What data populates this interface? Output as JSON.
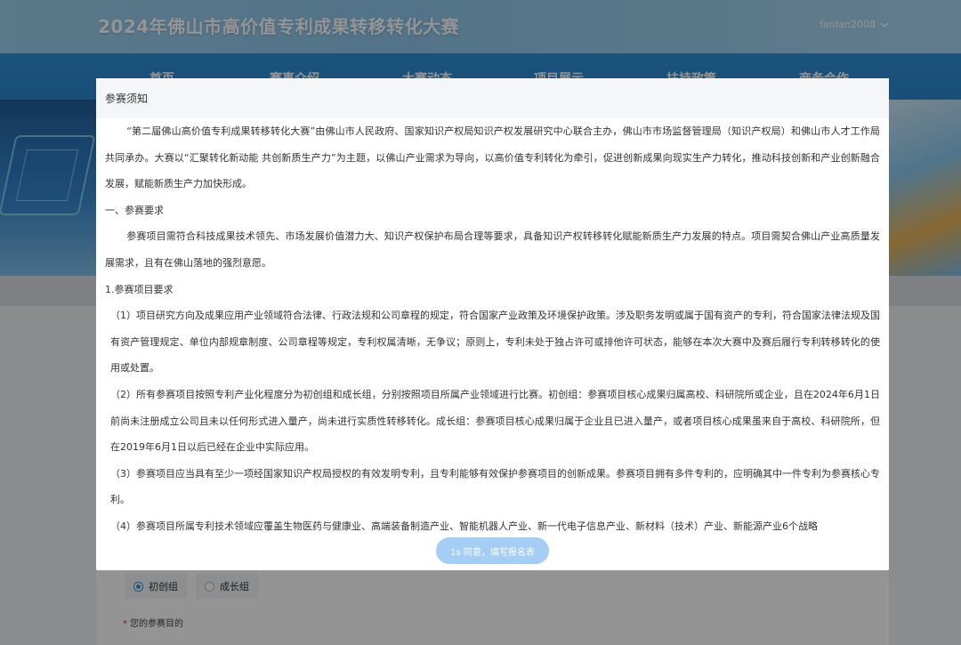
{
  "header": {
    "site_title": "2024年佛山市高价值专利成果转移转化大赛",
    "username": "fanfan2008"
  },
  "nav": {
    "items": [
      "首页",
      "赛事介绍",
      "大赛动态",
      "项目展示",
      "扶持政策",
      "商务合作"
    ]
  },
  "form": {
    "group_options": [
      {
        "label": "初创组",
        "selected": true
      },
      {
        "label": "成长组",
        "selected": false
      }
    ],
    "purpose_required_mark": "*",
    "purpose_label": "您的参赛目的"
  },
  "modal": {
    "title": "参赛须知",
    "paragraphs": [
      "“第二届佛山高价值专利成果转移转化大赛”由佛山市人民政府、国家知识产权局知识产权发展研究中心联合主办，佛山市市场监督管理局（知识产权局）和佛山市人才工作局共同承办。大赛以“汇聚转化新动能 共创新质生产力”为主题，以佛山产业需求为导向，以高价值专利转化为牵引，促进创新成果向现实生产力转化，推动科技创新和产业创新融合发展，赋能新质生产力加快形成。",
      "一、参赛要求",
      "参赛项目需符合科技成果技术领先、市场发展价值潜力大、知识产权保护布局合理等要求，具备知识产权转移转化赋能新质生产力发展的特点。项目需契合佛山产业高质量发展需求，且有在佛山落地的强烈意愿。",
      "1.参赛项目要求",
      "（1）项目研究方向及成果应用产业领域符合法律、行政法规和公司章程的规定，符合国家产业政策及环境保护政策。涉及职务发明或属于国有资产的专利，符合国家法律法规及国有资产管理规定、单位内部规章制度、公司章程等规定，专利权属清晰，无争议；原则上，专利未处于独占许可或排他许可状态，能够在本次大赛中及赛后履行专利转移转化的使用或处置。",
      "（2）所有参赛项目按照专利产业化程度分为初创组和成长组，分别按照项目所属产业领域进行比赛。初创组：参赛项目核心成果归属高校、科研院所或企业，且在2024年6月1日前尚未注册成立公司且未以任何形式进入量产，尚未进行实质性转移转化。成长组：参赛项目核心成果归属于企业且已进入量产，或者项目核心成果虽来自于高校、科研院所，但在2019年6月1日以后已经在企业中实际应用。",
      "（3）参赛项目应当具有至少一项经国家知识产权局授权的有效发明专利，且专利能够有效保护参赛项目的创新成果。参赛项目拥有多件专利的，应明确其中一件专利为参赛核心专利。",
      "（4）参赛项目所属专利技术领域应覆盖生物医药与健康业、高端装备制造产业、智能机器人产业、新一代电子信息产业、新材料（技术）产业、新能源产业6个战略"
    ],
    "agree_button": "1s 同意，填写报名表"
  }
}
